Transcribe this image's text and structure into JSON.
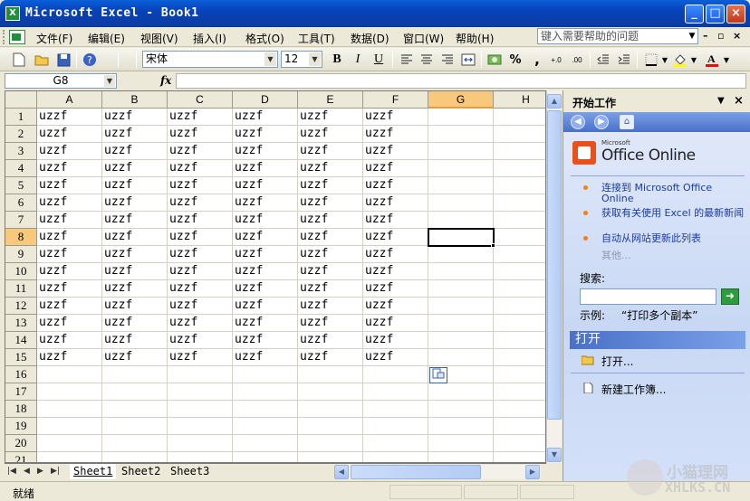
{
  "window": {
    "title": "Microsoft Excel - Book1",
    "minimize": "_",
    "maximize": "□",
    "close": "×"
  },
  "menu": {
    "items": [
      "文件(F)",
      "编辑(E)",
      "视图(V)",
      "插入(I)",
      "格式(O)",
      "工具(T)",
      "数据(D)",
      "窗口(W)",
      "帮助(H)"
    ],
    "help_placeholder": "键入需要帮助的问题"
  },
  "toolbar": {
    "font_name": "宋体",
    "font_size": "12",
    "bold": "B",
    "italic": "I",
    "underline": "U",
    "percent": "%",
    "comma": ",",
    "icons": [
      "new-icon",
      "open-icon",
      "save-icon",
      "help-icon",
      "align-left-icon",
      "align-center-icon",
      "align-right-icon",
      "merge-center-icon",
      "currency-icon",
      "increase-decimal-icon",
      "decrease-decimal-icon",
      "decrease-indent-icon",
      "increase-indent-icon",
      "borders-icon",
      "fill-color-icon",
      "font-color-icon"
    ]
  },
  "formula_bar": {
    "name_box": "G8",
    "fx": "fx",
    "value": ""
  },
  "grid": {
    "columns": [
      "A",
      "B",
      "C",
      "D",
      "E",
      "F",
      "G",
      "H"
    ],
    "rows": [
      "1",
      "2",
      "3",
      "4",
      "5",
      "6",
      "7",
      "8",
      "9",
      "10",
      "11",
      "12",
      "13",
      "14",
      "15",
      "16",
      "17",
      "18",
      "19",
      "20",
      "21"
    ],
    "selected_column": "G",
    "selected_row": "8",
    "active_cell": "G8",
    "cells": [
      [
        "uzzf",
        "uzzf",
        "uzzf",
        "uzzf",
        "uzzf",
        "uzzf"
      ],
      [
        "uzzf",
        "uzzf",
        "uzzf",
        "uzzf",
        "uzzf",
        "uzzf"
      ],
      [
        "uzzf",
        "uzzf",
        "uzzf",
        "uzzf",
        "uzzf",
        "uzzf"
      ],
      [
        "uzzf",
        "uzzf",
        "uzzf",
        "uzzf",
        "uzzf",
        "uzzf"
      ],
      [
        "uzzf",
        "uzzf",
        "uzzf",
        "uzzf",
        "uzzf",
        "uzzf"
      ],
      [
        "uzzf",
        "uzzf",
        "uzzf",
        "uzzf",
        "uzzf",
        "uzzf"
      ],
      [
        "uzzf",
        "uzzf",
        "uzzf",
        "uzzf",
        "uzzf",
        "uzzf"
      ],
      [
        "uzzf",
        "uzzf",
        "uzzf",
        "uzzf",
        "uzzf",
        "uzzf"
      ],
      [
        "uzzf",
        "uzzf",
        "uzzf",
        "uzzf",
        "uzzf",
        "uzzf"
      ],
      [
        "uzzf",
        "uzzf",
        "uzzf",
        "uzzf",
        "uzzf",
        "uzzf"
      ],
      [
        "uzzf",
        "uzzf",
        "uzzf",
        "uzzf",
        "uzzf",
        "uzzf"
      ],
      [
        "uzzf",
        "uzzf",
        "uzzf",
        "uzzf",
        "uzzf",
        "uzzf"
      ],
      [
        "uzzf",
        "uzzf",
        "uzzf",
        "uzzf",
        "uzzf",
        "uzzf"
      ],
      [
        "uzzf",
        "uzzf",
        "uzzf",
        "uzzf",
        "uzzf",
        "uzzf"
      ],
      [
        "uzzf",
        "uzzf",
        "uzzf",
        "uzzf",
        "uzzf",
        "uzzf"
      ]
    ]
  },
  "sheets": {
    "tabs": [
      "Sheet1",
      "Sheet2",
      "Sheet3"
    ],
    "active": "Sheet1"
  },
  "task_pane": {
    "title": "开始工作",
    "logo_small": "Microsoft",
    "logo_text": "Office Online",
    "links": [
      "连接到 Microsoft Office Online",
      "获取有关使用 Excel 的最新新闻",
      "自动从网站更新此列表"
    ],
    "more": "其他...",
    "search_label": "搜索:",
    "example_label": "示例:",
    "example_text": "“打印多个副本”",
    "open_section": "打开",
    "open_items": [
      "打开...",
      "新建工作簿..."
    ]
  },
  "status": {
    "text": "就绪"
  },
  "watermark": {
    "line1": "小猫理网",
    "line2": "XHLKS.CN"
  },
  "colors": {
    "titlebar": "#0842b8",
    "selected_header": "#f8c87c",
    "task_pane_bg": "#c8d8f4",
    "link": "#1a3aa8"
  }
}
